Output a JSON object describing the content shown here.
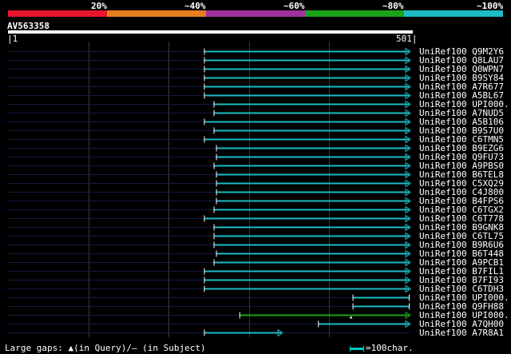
{
  "legend": {
    "colors": [
      "#e8152e",
      "#e87d1e",
      "#a0329b",
      "#1aa31a",
      "#1bbcc4"
    ],
    "labels": [
      "20%",
      "~40%",
      "~60%",
      "~80%",
      "~100%"
    ]
  },
  "query": {
    "name": "AV563358",
    "start_label": "1",
    "end_label": "501",
    "length": 501
  },
  "hits": [
    {
      "name": "UniRef100_Q9M2Y6",
      "start": 245,
      "end": 501,
      "color": "#1bbcc4",
      "arrow": true
    },
    {
      "name": "UniRef100_Q8LAU7",
      "start": 245,
      "end": 501,
      "color": "#1bbcc4",
      "arrow": true
    },
    {
      "name": "UniRef100_Q0WPN7",
      "start": 245,
      "end": 501,
      "color": "#1bbcc4",
      "arrow": true
    },
    {
      "name": "UniRef100_B9SY84",
      "start": 245,
      "end": 501,
      "color": "#1bbcc4",
      "arrow": true
    },
    {
      "name": "UniRef100_A7R677",
      "start": 245,
      "end": 501,
      "color": "#1bbcc4",
      "arrow": true
    },
    {
      "name": "UniRef100_A5BL67",
      "start": 245,
      "end": 501,
      "color": "#1bbcc4",
      "arrow": true
    },
    {
      "name": "UniRef100_UPI000..",
      "start": 257,
      "end": 501,
      "color": "#1bbcc4",
      "arrow": true
    },
    {
      "name": "UniRef100_A7NUD5",
      "start": 257,
      "end": 501,
      "color": "#1bbcc4",
      "arrow": true
    },
    {
      "name": "UniRef100_A5B106",
      "start": 245,
      "end": 501,
      "color": "#1bbcc4",
      "arrow": true
    },
    {
      "name": "UniRef100_B9S7U0",
      "start": 257,
      "end": 501,
      "color": "#1bbcc4",
      "arrow": true
    },
    {
      "name": "UniRef100_C6TMN5",
      "start": 245,
      "end": 501,
      "color": "#1bbcc4",
      "arrow": true
    },
    {
      "name": "UniRef100_B9EZG6",
      "start": 260,
      "end": 501,
      "color": "#1bbcc4",
      "arrow": true
    },
    {
      "name": "UniRef100_Q9FU73",
      "start": 260,
      "end": 501,
      "color": "#1bbcc4",
      "arrow": true
    },
    {
      "name": "UniRef100_A9PBS0",
      "start": 257,
      "end": 501,
      "color": "#1bbcc4",
      "arrow": true
    },
    {
      "name": "UniRef100_B6TEL8",
      "start": 260,
      "end": 501,
      "color": "#1bbcc4",
      "arrow": true
    },
    {
      "name": "UniRef100_C5XQ29",
      "start": 260,
      "end": 501,
      "color": "#1bbcc4",
      "arrow": true
    },
    {
      "name": "UniRef100_C4J800",
      "start": 260,
      "end": 501,
      "color": "#1bbcc4",
      "arrow": true
    },
    {
      "name": "UniRef100_B4FPS6",
      "start": 260,
      "end": 501,
      "color": "#1bbcc4",
      "arrow": true
    },
    {
      "name": "UniRef100_C6TGX2",
      "start": 257,
      "end": 501,
      "color": "#1bbcc4",
      "arrow": true
    },
    {
      "name": "UniRef100_C6T778",
      "start": 245,
      "end": 501,
      "color": "#1bbcc4",
      "arrow": true
    },
    {
      "name": "UniRef100_B9GNK8",
      "start": 257,
      "end": 501,
      "color": "#1bbcc4",
      "arrow": true
    },
    {
      "name": "UniRef100_C6TL75",
      "start": 257,
      "end": 501,
      "color": "#1bbcc4",
      "arrow": true
    },
    {
      "name": "UniRef100_B9R6U6",
      "start": 257,
      "end": 501,
      "color": "#1bbcc4",
      "arrow": true
    },
    {
      "name": "UniRef100_B6T448",
      "start": 260,
      "end": 501,
      "color": "#1bbcc4",
      "arrow": true
    },
    {
      "name": "UniRef100_A9PCB1",
      "start": 257,
      "end": 501,
      "color": "#1bbcc4",
      "arrow": true
    },
    {
      "name": "UniRef100_B7FIL1",
      "start": 245,
      "end": 501,
      "color": "#1bbcc4",
      "arrow": true
    },
    {
      "name": "UniRef100_B7FI93",
      "start": 245,
      "end": 501,
      "color": "#1bbcc4",
      "arrow": true
    },
    {
      "name": "UniRef100_C6TDH3",
      "start": 245,
      "end": 501,
      "color": "#1bbcc4",
      "arrow": true
    },
    {
      "name": "UniRef100_UPI000..",
      "start": 430,
      "end": 501,
      "color": "#1bbcc4",
      "arrow": false
    },
    {
      "name": "UniRef100_Q9FH88",
      "start": 430,
      "end": 501,
      "color": "#1bbcc4",
      "arrow": false
    },
    {
      "name": "UniRef100_UPI000..",
      "start": 289,
      "end": 501,
      "color": "#1aa31a",
      "arrow": true,
      "gap_at": 428
    },
    {
      "name": "UniRef100_A7QH00",
      "start": 387,
      "end": 501,
      "color": "#1bbcc4",
      "arrow": true
    },
    {
      "name": "UniRef100_A7R8A1",
      "start": 245,
      "end": 342,
      "color": "#1bbcc4",
      "arrow": true
    }
  ],
  "footer": {
    "gaps_text": "Large gaps: ▲(in Query)/– (in Subject)",
    "scale_text": "=100char."
  }
}
